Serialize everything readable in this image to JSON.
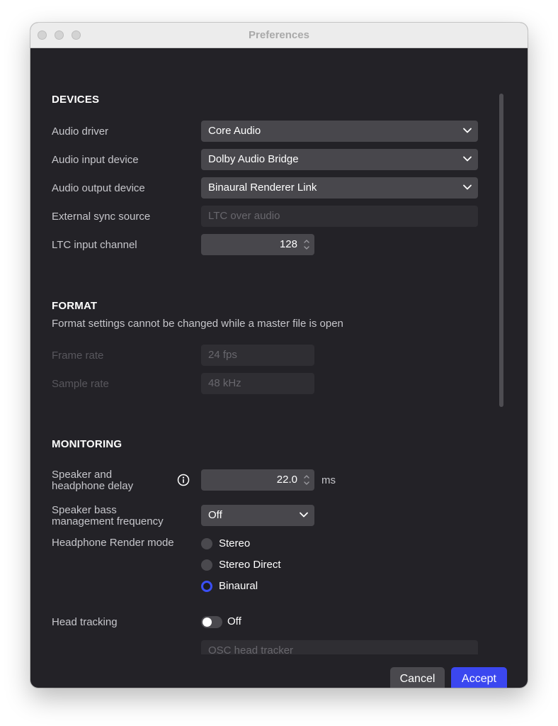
{
  "window": {
    "title": "Preferences"
  },
  "devices": {
    "heading": "DEVICES",
    "audio_driver": {
      "label": "Audio driver",
      "value": "Core Audio"
    },
    "audio_input": {
      "label": "Audio input device",
      "value": "Dolby Audio Bridge"
    },
    "audio_output": {
      "label": "Audio output device",
      "value": "Binaural Renderer Link"
    },
    "sync_source": {
      "label": "External sync source",
      "placeholder": "LTC over audio"
    },
    "ltc_channel": {
      "label": "LTC input channel",
      "value": "128"
    }
  },
  "format": {
    "heading": "FORMAT",
    "note": "Format settings cannot be changed while a master file is open",
    "frame_rate": {
      "label": "Frame rate",
      "value": "24 fps"
    },
    "sample_rate": {
      "label": "Sample rate",
      "value": "48 kHz"
    }
  },
  "monitoring": {
    "heading": "MONITORING",
    "delay": {
      "label_line1": "Speaker and",
      "label_line2": "headphone delay",
      "value": "22.0",
      "unit": "ms"
    },
    "bass": {
      "label_line1": "Speaker bass",
      "label_line2": "management frequency",
      "value": "Off"
    },
    "render_mode": {
      "label": "Headphone Render mode",
      "options": [
        "Stereo",
        "Stereo Direct",
        "Binaural"
      ],
      "selected": "Binaural"
    },
    "head_tracking": {
      "label": "Head tracking",
      "state": "Off",
      "tracker_placeholder": "OSC head tracker"
    }
  },
  "buttons": {
    "cancel": "Cancel",
    "accept": "Accept"
  },
  "colors": {
    "accent": "#3b47f0",
    "background": "#232227",
    "control": "#48474c"
  }
}
